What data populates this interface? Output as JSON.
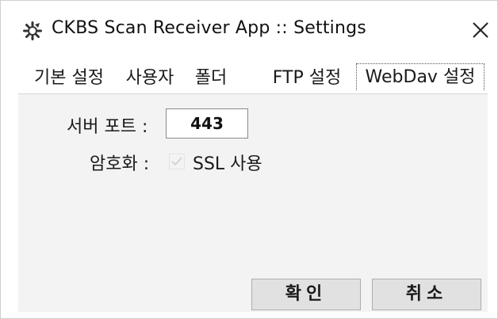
{
  "window": {
    "title": "CKBS Scan Receiver App :: Settings",
    "app_icon": "gear-icon",
    "close_icon": "close-icon"
  },
  "tabs": [
    {
      "label": "기본 설정",
      "active": false
    },
    {
      "label": "사용자",
      "active": false
    },
    {
      "label": "폴더",
      "active": false
    },
    {
      "label": "FTP 설정",
      "active": false
    },
    {
      "label": "WebDav 설정",
      "active": true
    }
  ],
  "form": {
    "server_port_label": "서버 포트 :",
    "server_port_value": "443",
    "encryption_label": "암호화 :",
    "ssl_label": "SSL 사용",
    "ssl_checked": true,
    "ssl_disabled": true
  },
  "buttons": {
    "ok_label": "확인",
    "cancel_label": "취소"
  },
  "colors": {
    "panel_bg": "#f3f3f3",
    "button_bg": "#e1e1e1",
    "text": "#1a1a1a"
  }
}
